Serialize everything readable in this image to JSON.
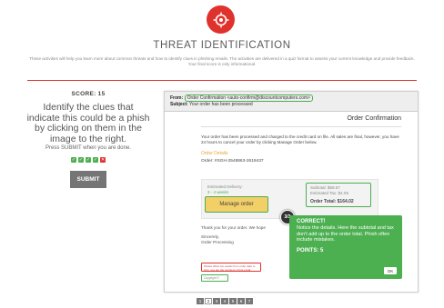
{
  "header": {
    "title": "THREAT IDENTIFICATION",
    "intro": "These activities will help you learn more about common threats and how to identify clues in phishing emails. The activities are delivered in a quiz format to assess your current knowledge and provide feedback. Your final score is only informational."
  },
  "sidebar": {
    "score": "SCORE: 15",
    "instructions": "Identify the clues that indicate this could be a phish by clicking on them in the image to the right.",
    "press": "Press SUBMIT when you are done.",
    "results": [
      "correct",
      "correct",
      "correct",
      "correct",
      "incorrect"
    ],
    "submit_label": "SUBMIT"
  },
  "email": {
    "from_label": "From:",
    "from_value": "Order Confirmation <auto-confirm@discountcomputers.com>",
    "subject_label": "Subject:",
    "subject_value": "Your order has been processed",
    "title": "Order Confirmation",
    "message": "Your order has been processed and charged to the credit card on file. All sales are final, however, you have 24 hours to cancel your order by clicking Manage Order below.",
    "order_details_label": "Order Details",
    "order_number": "Order: #SGH-2548863-2619437",
    "delivery_label": "Estimated Delivery:",
    "delivery_value": "3 - 4 weeks",
    "subtotal": "Subtotal: $59.57",
    "tax": "Estimated Tax: $4.05",
    "total": "Order Total: $164.02",
    "manage_label": "Manage order",
    "thanks": "Thank you for your order. We hope",
    "sincerely": "Sincerely,",
    "signature": "Order Processing",
    "warning": "Please allow two weeks from order date to ship, you are the recipient of this email.",
    "copyright": "Copyright © 2016"
  },
  "feedback": {
    "badge": "3/3",
    "title": "CORRECT!",
    "text": "Notice the details. Here the subtotal and tax don't add up to the order total. Phish often include mistakes.",
    "points": "POINTS: 5",
    "ok_label": "OK"
  },
  "pager": {
    "pages": [
      "1",
      "2",
      "3",
      "4",
      "5",
      "6",
      "7"
    ],
    "active_index": 1
  },
  "colors": {
    "accent_red": "#e0322c",
    "correct_green": "#4caf50",
    "manage_yellow": "#f2cf67"
  },
  "icons": {
    "logo": "target-icon"
  }
}
